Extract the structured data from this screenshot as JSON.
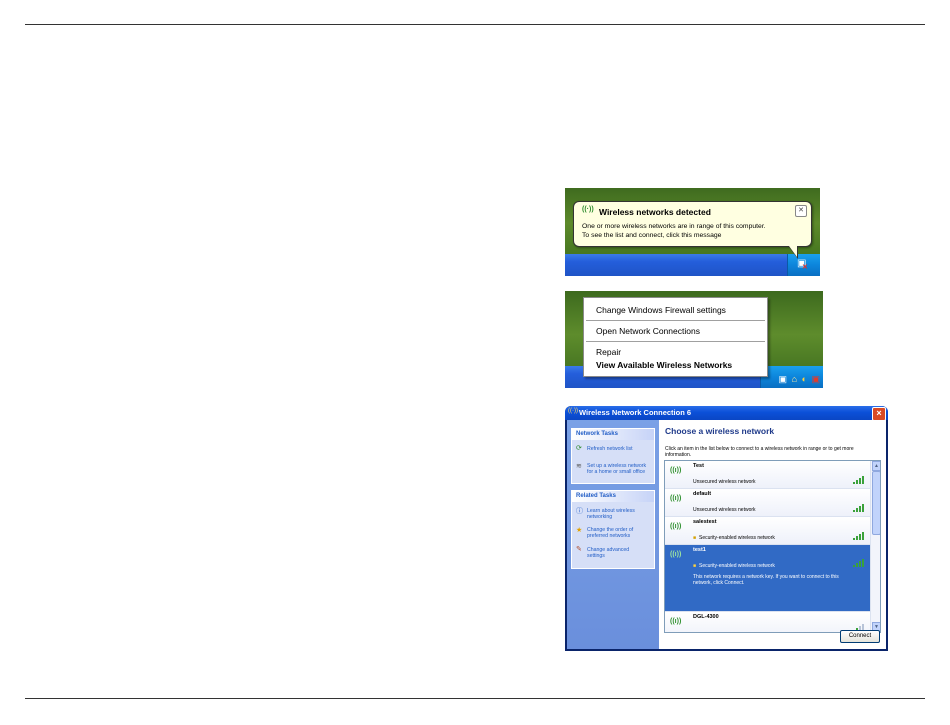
{
  "balloon": {
    "title": "Wireless networks detected",
    "line1": "One or more wireless networks are in range of this computer.",
    "line2": "To see the list and connect, click this message",
    "close_glyph": "✕",
    "icon": "wireless-icon"
  },
  "context_menu": {
    "items": [
      {
        "label": "Change Windows Firewall settings"
      },
      {
        "label": "Open Network Connections"
      },
      {
        "label": "Repair"
      },
      {
        "label": "View Available Wireless Networks"
      }
    ]
  },
  "dialog": {
    "title": "Wireless Network Connection 6",
    "heading": "Choose a wireless network",
    "description": "Click an item in the list below to connect to a wireless network in range or to get more information.",
    "network_tasks": {
      "header": "Network Tasks",
      "items": [
        "Refresh network list",
        "Set up a wireless network for a home or small office"
      ]
    },
    "related_tasks": {
      "header": "Related Tasks",
      "items": [
        "Learn about wireless networking",
        "Change the order of preferred networks",
        "Change advanced settings"
      ]
    },
    "networks": [
      {
        "name": "Test",
        "status": "Unsecured wireless network",
        "signal": 4
      },
      {
        "name": "default",
        "status": "Unsecured wireless network",
        "signal": 4
      },
      {
        "name": "salestest",
        "status": "Security-enabled wireless network",
        "signal": 4
      },
      {
        "name": "test1",
        "status": "Security-enabled wireless network",
        "note": "This network requires a network key. If you want to connect to this network, click Connect.",
        "signal": 4,
        "selected": true
      },
      {
        "name": "DGL-4300",
        "status": "",
        "signal": 2
      }
    ],
    "connect_button": "Connect"
  }
}
